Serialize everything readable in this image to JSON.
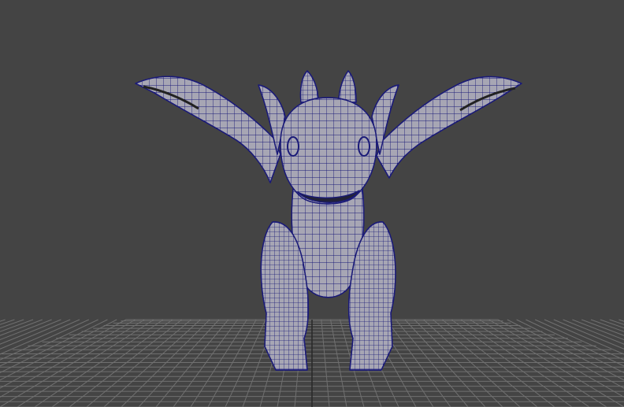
{
  "viewport": {
    "panel": "perspective-viewport",
    "background_color": "#444444",
    "display_mode": "wireframe-on-shaded"
  },
  "scene": {
    "model": {
      "icon": "dragon-mesh",
      "surface_color": "#a7a6b4",
      "wire_color": "#1a1a78"
    },
    "ground_grid": {
      "icon": "grid-plane",
      "line_color": "#707070",
      "center_line_color": "#2a2a2a",
      "visible": true
    }
  }
}
